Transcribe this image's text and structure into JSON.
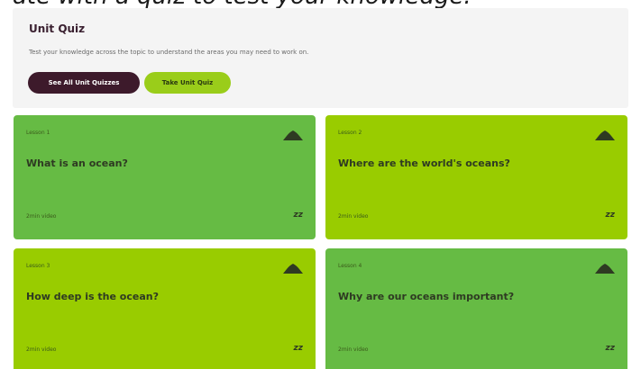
{
  "caption": "ate with a quiz to test your knowledge.",
  "quiz": {
    "title": "Unit Quiz",
    "description": "Test your knowledge across the topic to understand the areas you may need to work on.",
    "see_all_label": "See All Unit Quizzes",
    "take_quiz_label": "Take Unit Quiz"
  },
  "cards": [
    {
      "lesson": "Lesson 1",
      "title": "What is an ocean?",
      "duration": "2min video",
      "color": "#66bb44"
    },
    {
      "lesson": "Lesson 2",
      "title": "Where are the world's oceans?",
      "duration": "2min video",
      "color": "#99cc00"
    },
    {
      "lesson": "Lesson 3",
      "title": "How deep is the ocean?",
      "duration": "2min video",
      "color": "#99cc00"
    },
    {
      "lesson": "Lesson 4",
      "title": "Why are our oceans important?",
      "duration": "2min video",
      "color": "#66bb44"
    }
  ],
  "icons": {
    "card_top": "mound-icon",
    "card_bottom": "snooze-icon",
    "snooze_glyph": "zz"
  }
}
